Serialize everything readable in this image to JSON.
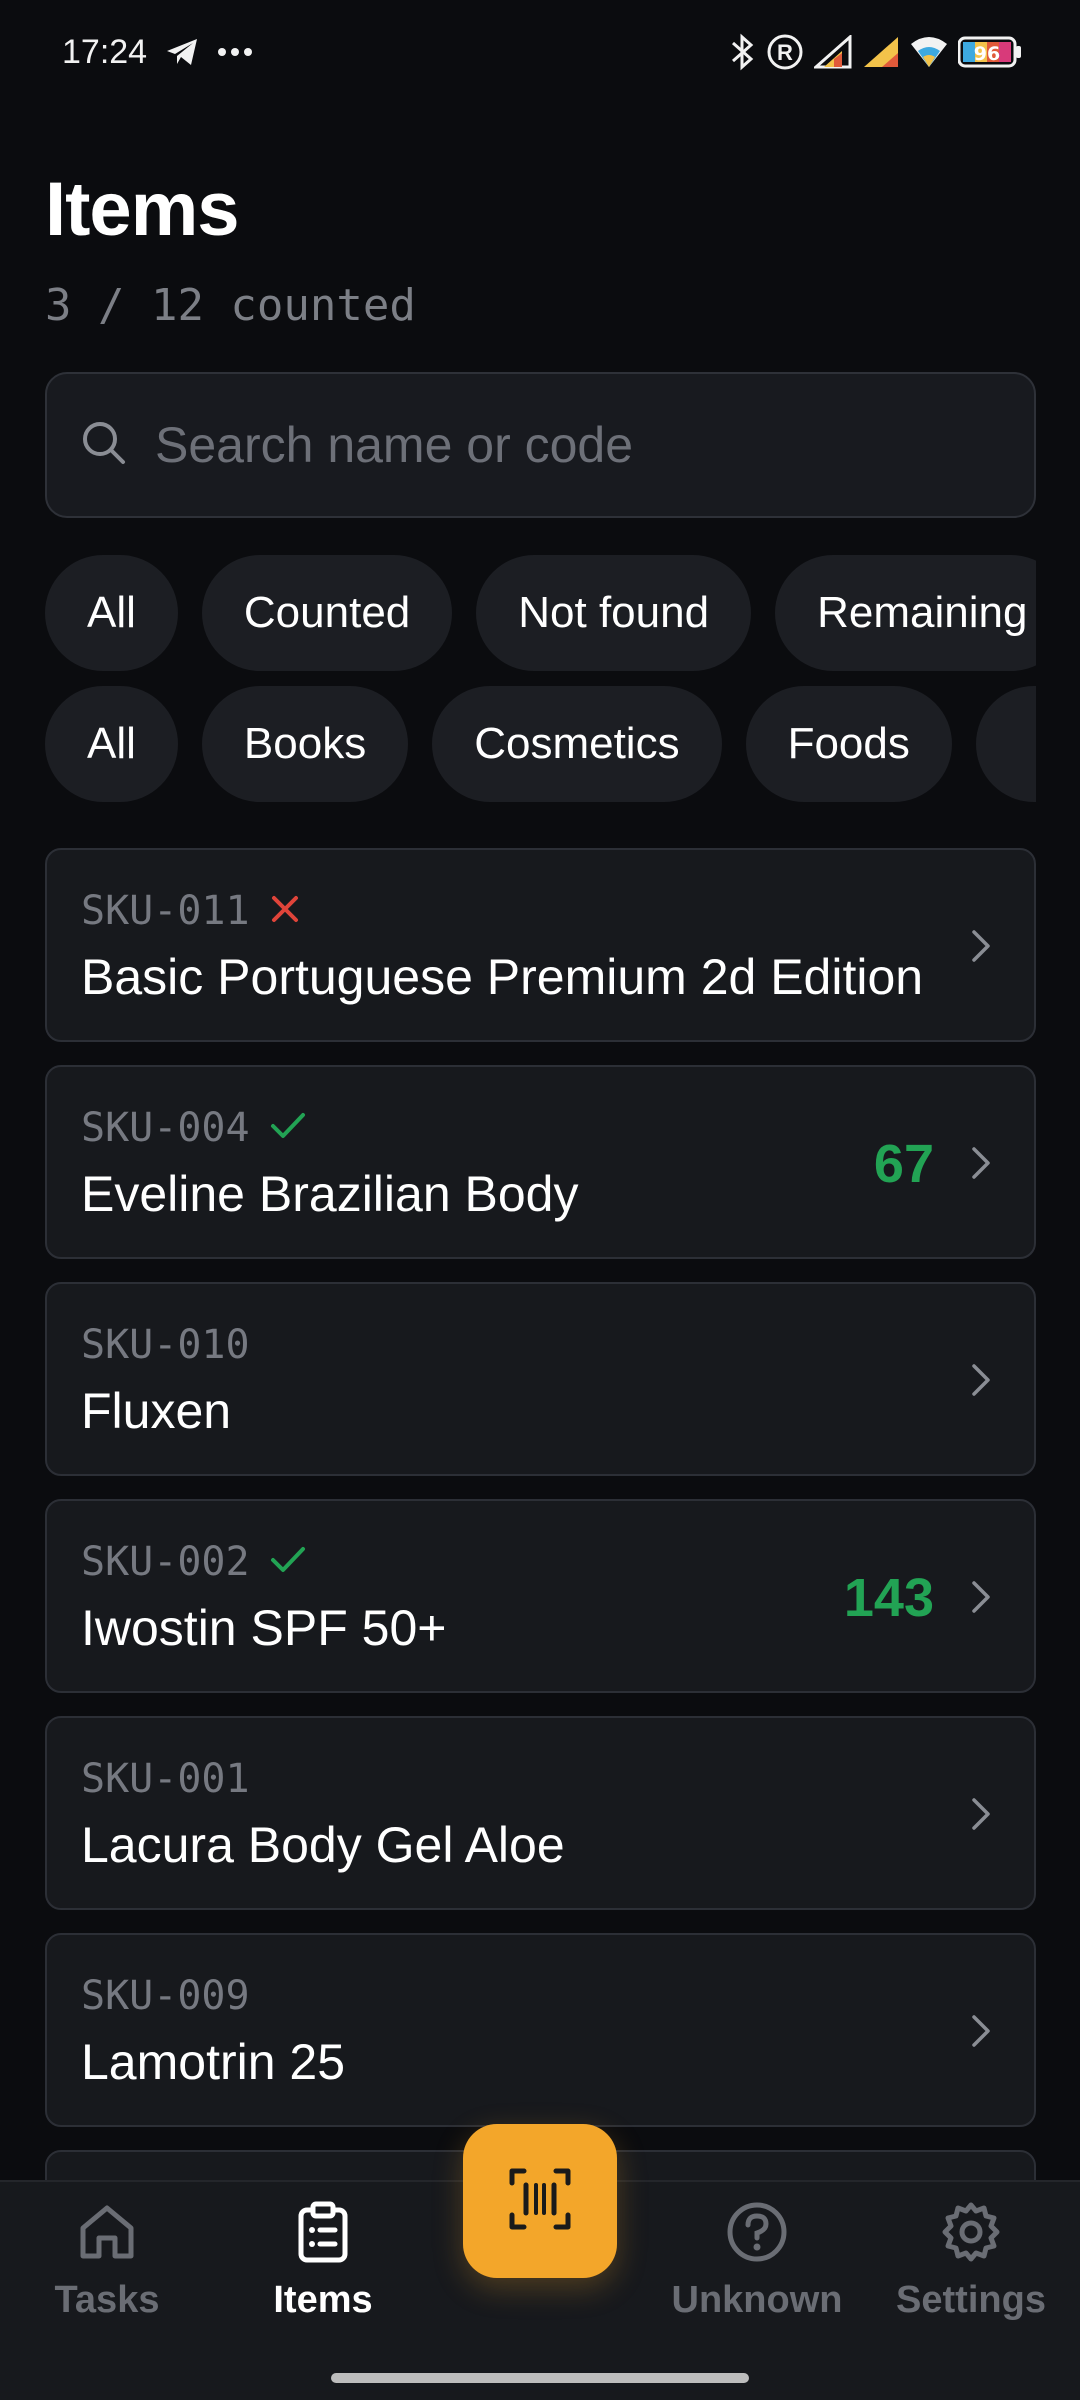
{
  "status_bar": {
    "time": "17:24",
    "icons_left": [
      "telegram-icon",
      "more-icon"
    ],
    "icons_right": [
      "bluetooth-icon",
      "registered-icon",
      "signal-icon",
      "signal-icon",
      "wifi-icon",
      "battery-icon"
    ],
    "battery_level": "96"
  },
  "header": {
    "title": "Items",
    "subtitle": "3 / 12 counted"
  },
  "search": {
    "placeholder": "Search name or code",
    "value": ""
  },
  "status_filters": [
    {
      "label": "All"
    },
    {
      "label": "Counted"
    },
    {
      "label": "Not found"
    },
    {
      "label": "Remaining"
    }
  ],
  "category_filters": [
    {
      "label": "All"
    },
    {
      "label": "Books"
    },
    {
      "label": "Cosmetics"
    },
    {
      "label": "Foods"
    },
    {
      "label": ""
    }
  ],
  "items": [
    {
      "sku": "SKU-011",
      "status": "not-found",
      "name": "Basic Portuguese Premium 2d Edition",
      "qty": ""
    },
    {
      "sku": "SKU-004",
      "status": "counted",
      "name": "Eveline Brazilian Body",
      "qty": "67"
    },
    {
      "sku": "SKU-010",
      "status": "none",
      "name": "Fluxen",
      "qty": ""
    },
    {
      "sku": "SKU-002",
      "status": "counted",
      "name": "Iwostin SPF 50+",
      "qty": "143"
    },
    {
      "sku": "SKU-001",
      "status": "none",
      "name": "Lacura Body Gel Aloe",
      "qty": ""
    },
    {
      "sku": "SKU-009",
      "status": "none",
      "name": "Lamotrin 25",
      "qty": ""
    }
  ],
  "bottom_nav": {
    "tasks": "Tasks",
    "items": "Items",
    "unknown": "Unknown",
    "settings": "Settings"
  },
  "colors": {
    "accent": "#f3a62a",
    "counted": "#22a354",
    "not_found": "#e0443a"
  }
}
